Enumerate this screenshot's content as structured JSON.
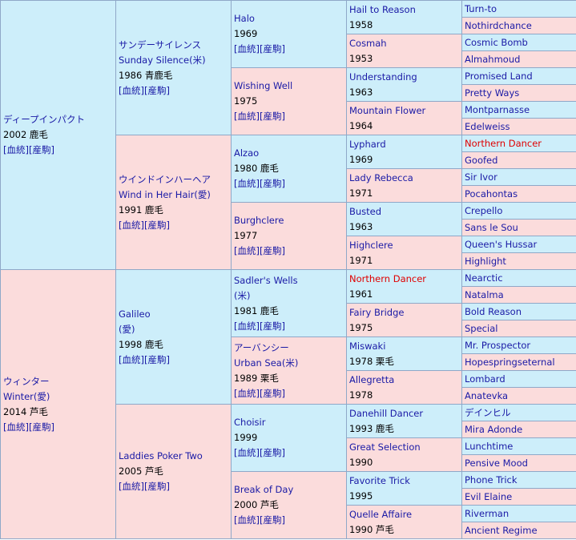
{
  "g1": [
    {
      "name": "ディープインパクト",
      "year": "2002 鹿毛",
      "links": [
        "[血統]",
        "[産駒]"
      ]
    },
    {
      "name": "ウィンター",
      "name2": "Winter(愛)",
      "year": "2014 芦毛",
      "links": [
        "[血統]",
        "[産駒]"
      ]
    }
  ],
  "g2": [
    {
      "name": "サンデーサイレンス",
      "name2": "Sunday Silence(米)",
      "year": "1986 青鹿毛",
      "links": [
        "[血統]",
        "[産駒]"
      ]
    },
    {
      "name": "ウインドインハーヘア",
      "name2": "Wind in Her Hair(愛)",
      "year": "1991 鹿毛",
      "links": [
        "[血統]",
        "[産駒]"
      ]
    },
    {
      "name": "Galileo",
      "name2": "(愛)",
      "year": "1998 鹿毛",
      "links": [
        "[血統]",
        "[産駒]"
      ]
    },
    {
      "name": "Laddies Poker Two",
      "year": "2005 芦毛",
      "links": [
        "[血統]",
        "[産駒]"
      ]
    }
  ],
  "g3": [
    {
      "name": "Halo",
      "year": "1969",
      "links": [
        "[血統]",
        "[産駒]"
      ]
    },
    {
      "name": "Wishing Well",
      "year": "1975",
      "links": [
        "[血統]",
        "[産駒]"
      ]
    },
    {
      "name": "Alzao",
      "year": "1980 鹿毛",
      "links": [
        "[血統]",
        "[産駒]"
      ]
    },
    {
      "name": "Burghclere",
      "year": "1977",
      "links": [
        "[血統]",
        "[産駒]"
      ]
    },
    {
      "name": "Sadler's Wells",
      "name2": "(米)",
      "year": "1981 鹿毛",
      "links": [
        "[血統]",
        "[産駒]"
      ]
    },
    {
      "name": "アーバンシー",
      "name2": "Urban Sea(米)",
      "year": "1989 栗毛",
      "links": [
        "[血統]",
        "[産駒]"
      ]
    },
    {
      "name": "Choisir",
      "year": "1999",
      "links": [
        "[血統]",
        "[産駒]"
      ]
    },
    {
      "name": "Break of Day",
      "year": "2000 芦毛",
      "links": [
        "[血統]",
        "[産駒]"
      ]
    }
  ],
  "g4": [
    {
      "name": "Hail to Reason",
      "year": "1958"
    },
    {
      "name": "Cosmah",
      "year": "1953"
    },
    {
      "name": "Understanding",
      "year": "1963"
    },
    {
      "name": "Mountain Flower",
      "year": "1964"
    },
    {
      "name": "Lyphard",
      "year": "1969"
    },
    {
      "name": "Lady Rebecca",
      "year": "1971"
    },
    {
      "name": "Busted",
      "year": "1963"
    },
    {
      "name": "Highclere",
      "year": "1971"
    },
    {
      "name": "Northern Dancer",
      "year": "1961"
    },
    {
      "name": "Fairy Bridge",
      "year": "1975"
    },
    {
      "name": "Miswaki",
      "year": "1978 栗毛"
    },
    {
      "name": "Allegretta",
      "year": "1978"
    },
    {
      "name": "Danehill Dancer",
      "year": "1993 鹿毛"
    },
    {
      "name": "Great Selection",
      "year": "1990"
    },
    {
      "name": "Favorite Trick",
      "year": "1995"
    },
    {
      "name": "Quelle Affaire",
      "year": "1990 芦毛"
    }
  ],
  "g5": [
    "Turn-to",
    "Nothirdchance",
    "Cosmic Bomb",
    "Almahmoud",
    "Promised Land",
    "Pretty Ways",
    "Montparnasse",
    "Edelweiss",
    "Northern Dancer",
    "Goofed",
    "Sir Ivor",
    "Pocahontas",
    "Crepello",
    "Sans le Sou",
    "Queen's Hussar",
    "Highlight",
    "Nearctic",
    "Natalma",
    "Bold Reason",
    "Special",
    "Mr. Prospector",
    "Hopespringseternal",
    "Lombard",
    "Anatevka",
    "デインヒル",
    "Mira Adonde",
    "Lunchtime",
    "Pensive Mood",
    "Phone Trick",
    "Evil Elaine",
    "Riverman",
    "Ancient Regime"
  ],
  "colors": {
    "sire_bg": "#cdeefa",
    "dam_bg": "#fbdcdc",
    "link": "#1a1aa6",
    "highlight": "#e00000",
    "border": "#8fa8c8"
  },
  "highlight_names": [
    "Northern Dancer"
  ]
}
